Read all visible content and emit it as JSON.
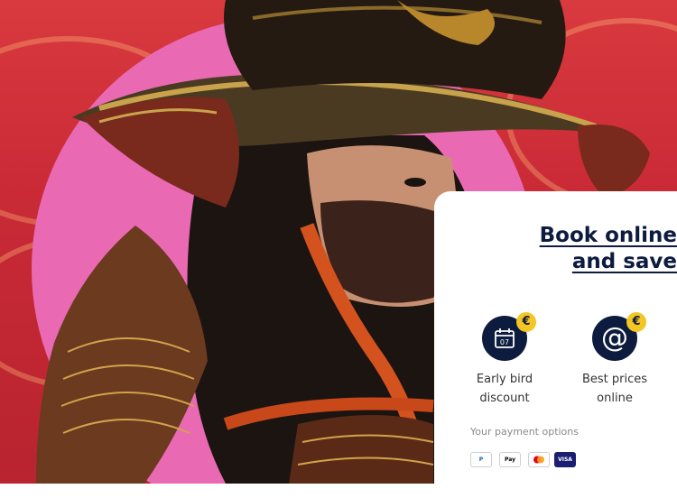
{
  "promo": {
    "title_line1": "Book online",
    "title_line2": "and save"
  },
  "features": [
    {
      "icon": "calendar-icon",
      "badge": "€",
      "day": "07",
      "line1": "Early bird",
      "line2": "discount"
    },
    {
      "icon": "at-sign-icon",
      "badge": "€",
      "symbol": "@",
      "line1": "Best prices",
      "line2": "online"
    }
  ],
  "payment": {
    "label": "Your payment options",
    "methods": [
      {
        "name": "PayPal",
        "short": "P"
      },
      {
        "name": "Apple Pay",
        "short": "Pay"
      },
      {
        "name": "Mastercard",
        "short": ""
      },
      {
        "name": "Visa",
        "short": "VISA"
      }
    ]
  },
  "colors": {
    "navy": "#0d1b3e",
    "pink": "#e96ab3",
    "red": "#d93a3f",
    "gold": "#f3c623"
  }
}
